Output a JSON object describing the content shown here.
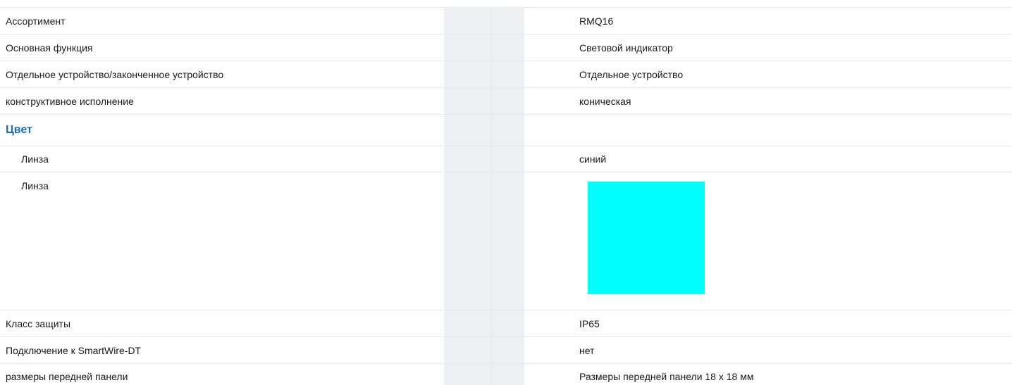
{
  "rows": [
    {
      "label": "Ассортимент",
      "value": "RMQ16"
    },
    {
      "label": "Основная функция",
      "value": "Световой индикатор"
    },
    {
      "label": "Отдельное устройство/законченное устройство",
      "value": "Отдельное устройство"
    },
    {
      "label": "конструктивное исполнение",
      "value": "коническая"
    }
  ],
  "color_group": {
    "title": "Цвет",
    "lens_label": "Линза",
    "lens_value": "синий",
    "lens_swatch_label": "Линза",
    "lens_swatch_color": "#00ffff"
  },
  "rows_after": [
    {
      "label": "Класс защиты",
      "value": "IP65"
    },
    {
      "label": "Подключение к SmartWire-DT",
      "value": "нет"
    },
    {
      "label": "размеры передней панели",
      "value": "Размеры передней панели 18 x 18 мм"
    }
  ],
  "colors": {
    "accent": "#1a6ec0",
    "column_shade": "#eef0f4"
  }
}
